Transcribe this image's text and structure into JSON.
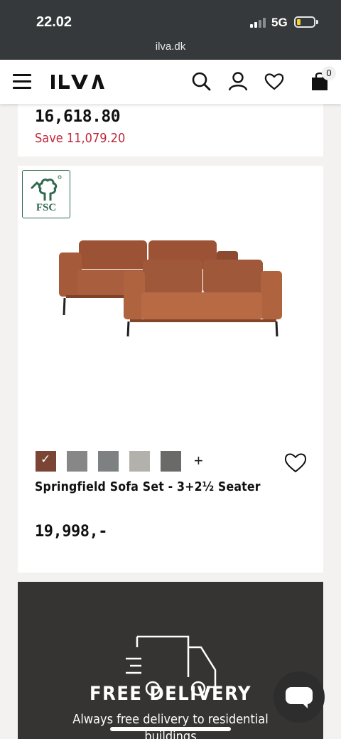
{
  "status_bar": {
    "time": "22.02",
    "network": "5G",
    "url": "ilva.dk"
  },
  "header": {
    "logo_text": "ILVA",
    "cart_count": "0",
    "icons": [
      "menu-icon",
      "search-icon",
      "user-icon",
      "heart-icon",
      "bag-icon"
    ]
  },
  "previous_product": {
    "price": "16,618.80",
    "save_text": "Save 11,079.20",
    "save_color": "#c0273a"
  },
  "product": {
    "badge_text": "FSC",
    "name": "Springfield Sofa Set - 3+2½ Seater",
    "price": "19,998,-",
    "more_colors_label": "+",
    "swatches": [
      {
        "color": "#7a4534",
        "selected": true
      },
      {
        "color": "#878787",
        "selected": false
      },
      {
        "color": "#7d8182",
        "selected": false
      },
      {
        "color": "#b2b1ac",
        "selected": false
      },
      {
        "color": "#6a6a68",
        "selected": false
      }
    ]
  },
  "promo": {
    "title": "FREE DELIVERY",
    "subtitle": "Always free delivery to residential buildings"
  },
  "colors": {
    "status_bar_bg": "#36393b",
    "promo_bg": "#353433",
    "sofa": "#a55a3a"
  }
}
